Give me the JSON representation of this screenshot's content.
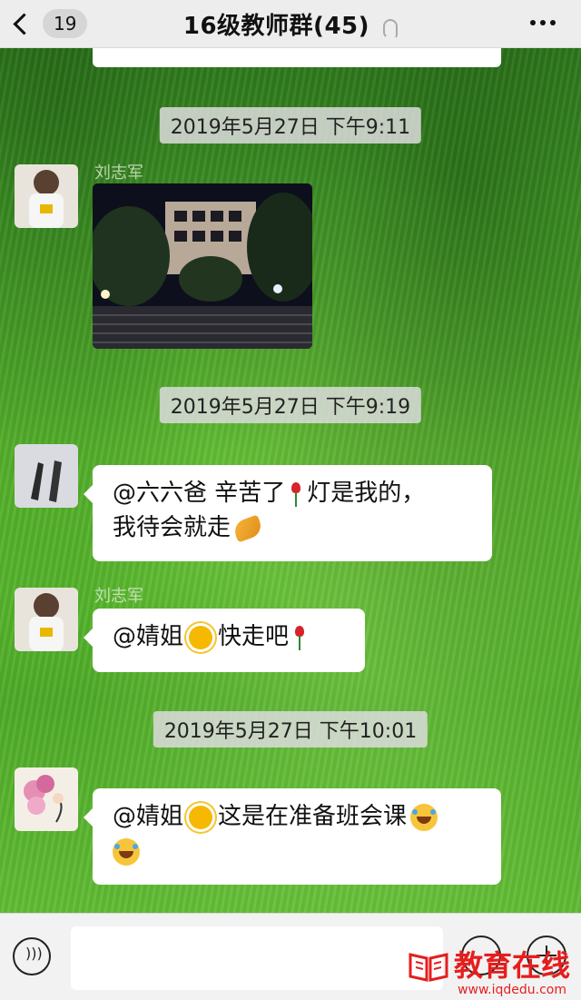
{
  "header": {
    "unread_count": "19",
    "title": "16级教师群(45)"
  },
  "messages": [
    {
      "type": "timestamp",
      "text": "2019年5月27日 下午9:11"
    },
    {
      "type": "image",
      "sender": "刘志军",
      "image_desc": "night-building-photo"
    },
    {
      "type": "timestamp",
      "text": "2019年5月27日 下午9:19"
    },
    {
      "type": "text",
      "sender": "",
      "line1_pre": "@六六爸 辛苦了",
      "line1_post": "灯是我的，",
      "line2": "我待会就走"
    },
    {
      "type": "text",
      "sender": "刘志军",
      "line1_pre": "@婧姐",
      "line1_post": "快走吧"
    },
    {
      "type": "timestamp",
      "text": "2019年5月27日 下午10:01"
    },
    {
      "type": "text",
      "sender": "",
      "line1_pre": "@婧姐",
      "line1_post": "这是在准备班会课"
    }
  ],
  "watermark": {
    "brand": "教育在线",
    "url": "www.iqdedu.com"
  },
  "icons": [
    "back-chevron-icon",
    "ear-icon",
    "more-icon",
    "voice-icon",
    "emoji-icon",
    "plus-icon",
    "rose-emoji",
    "sun-emoji",
    "laugh-emoji",
    "hands-emoji"
  ]
}
